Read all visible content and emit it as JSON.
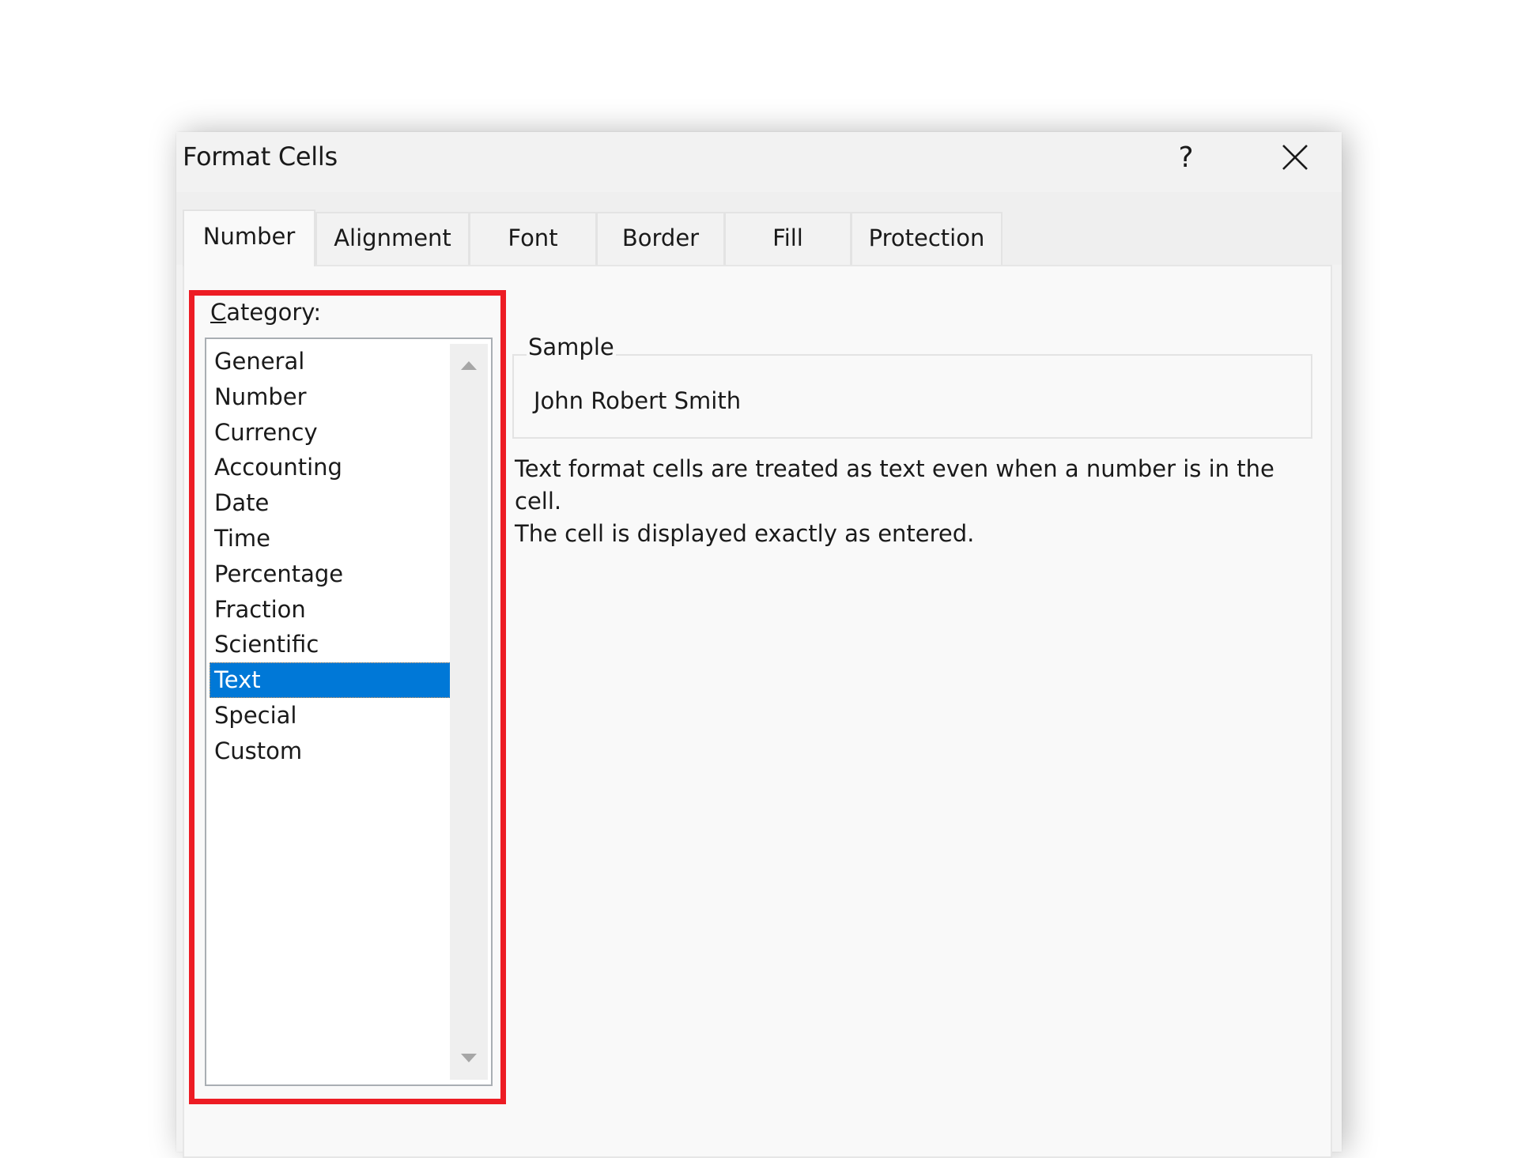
{
  "dialog": {
    "title": "Format Cells",
    "help_label": "?",
    "close_icon": "close-icon"
  },
  "tabs": [
    {
      "label": "Number",
      "active": true
    },
    {
      "label": "Alignment",
      "active": false
    },
    {
      "label": "Font",
      "active": false
    },
    {
      "label": "Border",
      "active": false
    },
    {
      "label": "Fill",
      "active": false
    },
    {
      "label": "Protection",
      "active": false
    }
  ],
  "category": {
    "label_access_key": "C",
    "label_rest": "ategory:",
    "items": [
      "General",
      "Number",
      "Currency",
      "Accounting",
      "Date",
      "Time",
      "Percentage",
      "Fraction",
      "Scientific",
      "Text",
      "Special",
      "Custom"
    ],
    "selected": "Text"
  },
  "sample": {
    "label": "Sample",
    "value": "John Robert Smith"
  },
  "description": {
    "line1": "Text format cells are treated as text even when a number is in the cell.",
    "line2": "The cell is displayed exactly as entered."
  },
  "colors": {
    "selection": "#0078d7",
    "highlight_box": "#ed1c24"
  }
}
